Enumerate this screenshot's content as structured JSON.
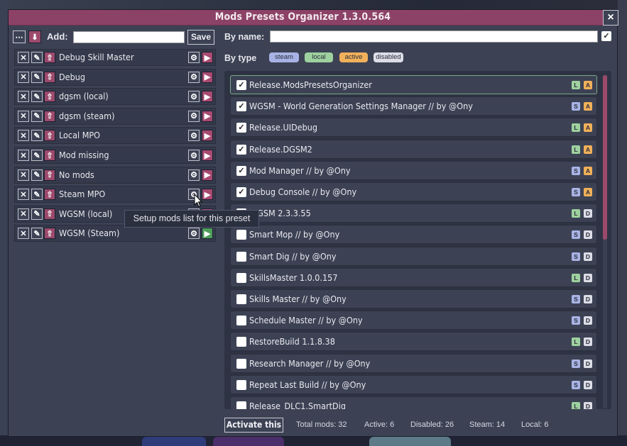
{
  "window": {
    "title": "Mods Presets Organizer 1.3.0.564",
    "close_label": "×"
  },
  "toolbar": {
    "more_icon": "⋯",
    "download_icon": "⬇",
    "add_label": "Add:",
    "add_value": "",
    "save_label": "Save"
  },
  "presets": [
    {
      "name": "Debug Skill Master",
      "active": false
    },
    {
      "name": "Debug",
      "active": false
    },
    {
      "name": "dgsm (local)",
      "active": false
    },
    {
      "name": "dgsm (steam)",
      "active": false
    },
    {
      "name": "Local MPO",
      "active": false
    },
    {
      "name": "Mod missing",
      "active": false
    },
    {
      "name": "No mods",
      "active": false
    },
    {
      "name": "Steam MPO",
      "active": false
    },
    {
      "name": "WGSM (local)",
      "active": false
    },
    {
      "name": "WGSM (Steam)",
      "active": true
    }
  ],
  "preset_icons": {
    "delete": "✕",
    "edit": "✎",
    "up": "⇧",
    "gear": "⚙",
    "play": "▶"
  },
  "tooltip": "Setup mods list for this preset",
  "filter": {
    "by_name_label": "By name:",
    "by_name_value": "",
    "by_type_label": "By type",
    "types": {
      "steam": "steam",
      "local": "local",
      "active": "active",
      "disabled": "disabled"
    }
  },
  "mods": [
    {
      "name": "Release.ModsPresetsOrganizer",
      "checked": true,
      "source": "L",
      "state": "A"
    },
    {
      "name": "WGSM - World Generation Settings Manager // by @Ony",
      "checked": true,
      "source": "S",
      "state": "A"
    },
    {
      "name": "Release.UIDebug",
      "checked": true,
      "source": "L",
      "state": "A"
    },
    {
      "name": "Release.DGSM2",
      "checked": true,
      "source": "L",
      "state": "A"
    },
    {
      "name": "Mod Manager // by @Ony",
      "checked": true,
      "source": "S",
      "state": "A"
    },
    {
      "name": "Debug Console // by @Ony",
      "checked": true,
      "source": "S",
      "state": "A"
    },
    {
      "name": "WGSM 2.3.3.55",
      "checked": false,
      "source": "L",
      "state": "D"
    },
    {
      "name": "Smart Mop // by @Ony",
      "checked": false,
      "source": "S",
      "state": "D"
    },
    {
      "name": "Smart Dig // by @Ony",
      "checked": false,
      "source": "S",
      "state": "D"
    },
    {
      "name": "SkillsMaster 1.0.0.157",
      "checked": false,
      "source": "L",
      "state": "D"
    },
    {
      "name": "Skills Master // by @Ony",
      "checked": false,
      "source": "S",
      "state": "D"
    },
    {
      "name": "Schedule Master // by @Ony",
      "checked": false,
      "source": "S",
      "state": "D"
    },
    {
      "name": "RestoreBuild 1.1.8.38",
      "checked": false,
      "source": "L",
      "state": "D"
    },
    {
      "name": "Research Manager // by @Ony",
      "checked": false,
      "source": "S",
      "state": "D"
    },
    {
      "name": "Repeat Last Build // by @Ony",
      "checked": false,
      "source": "S",
      "state": "D"
    },
    {
      "name": "Release_DLC1.SmartDig",
      "checked": false,
      "source": "L",
      "state": "D"
    }
  ],
  "footer": {
    "activate_label": "Activate this",
    "total_label": "Total mods: 32",
    "active_label": "Active: 6",
    "disabled_label": "Disabled: 26",
    "steam_label": "Steam: 14",
    "local_label": "Local: 6"
  },
  "colors": {
    "accent": "#8c4266",
    "panel": "#3c4254",
    "steam": "#a8b3e5",
    "local": "#9ed19f",
    "active": "#f1b05a",
    "disabled": "#dcdde6",
    "play_active": "#4d9d5a"
  }
}
